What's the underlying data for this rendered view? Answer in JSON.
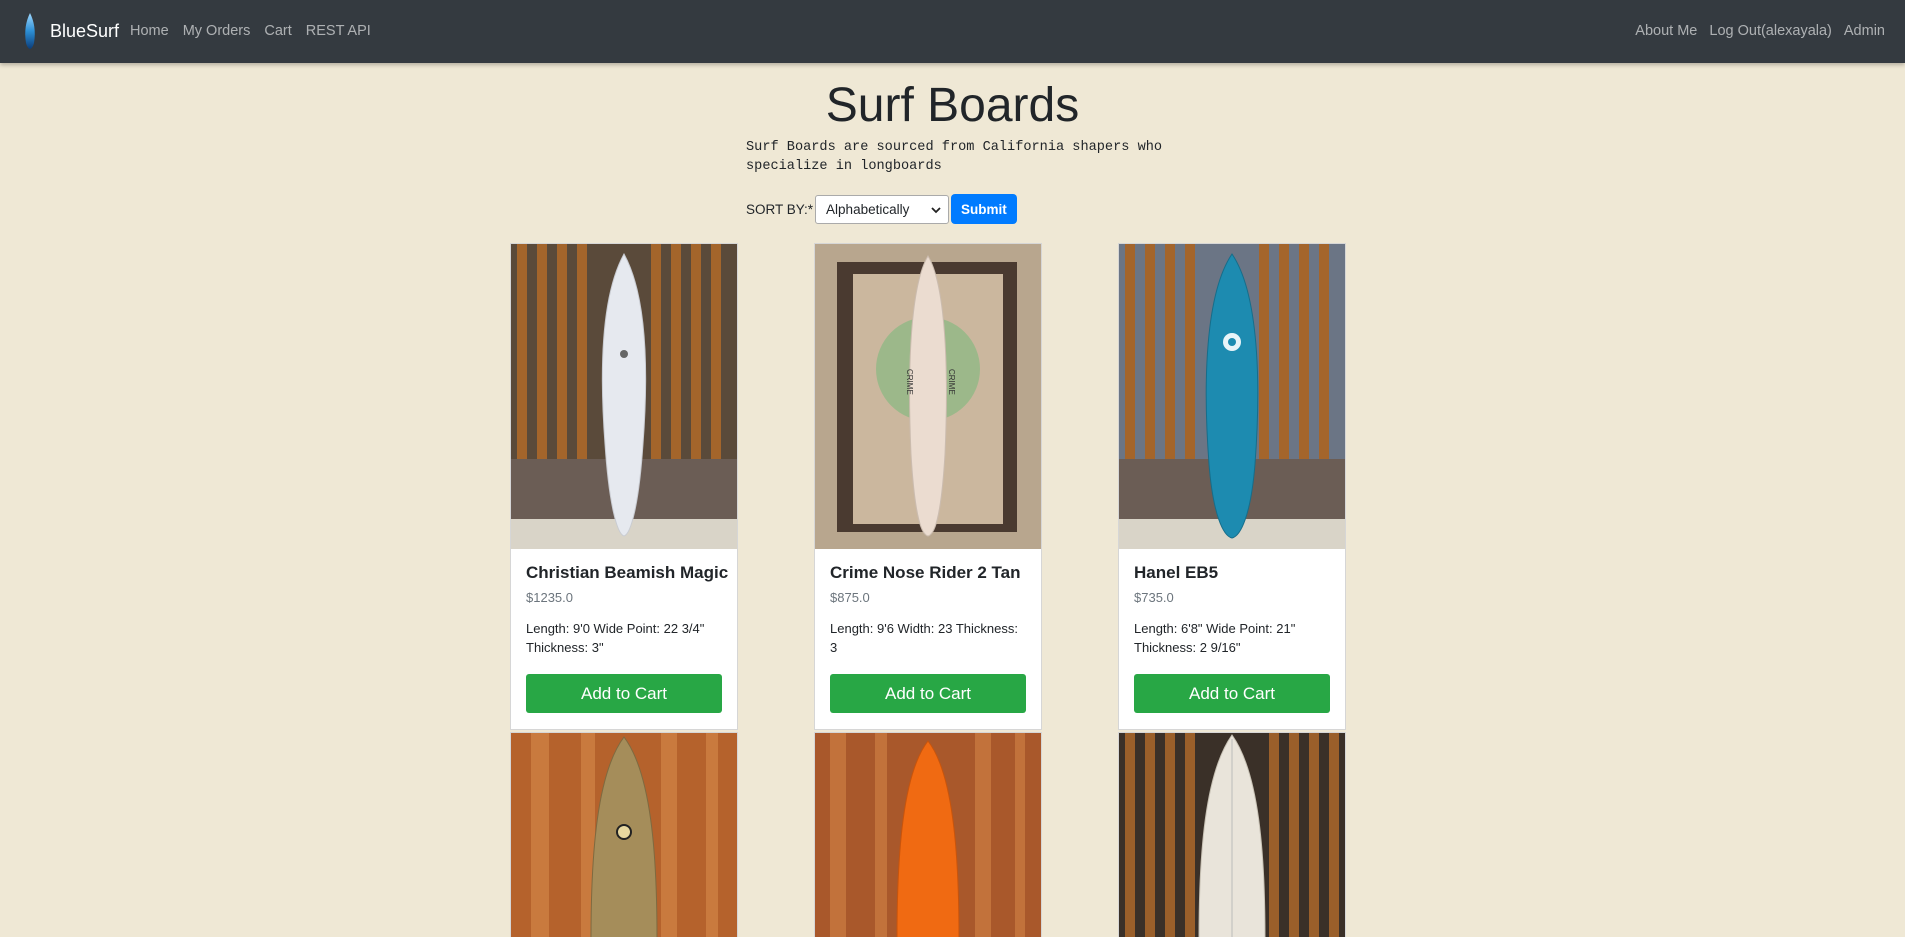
{
  "nav": {
    "brand": "BlueSurf",
    "left_links": [
      "Home",
      "My Orders",
      "Cart",
      "REST API"
    ],
    "right_links": [
      "About Me",
      "Log Out(alexayala)",
      "Admin"
    ]
  },
  "page": {
    "title": "Surf Boards",
    "description": "Surf Boards are sourced from California shapers who specialize in longboards"
  },
  "sort": {
    "label": "SORT BY:*",
    "selected": "Alphabetically",
    "submit_label": "Submit"
  },
  "products": [
    {
      "name": "Christian Beamish Magic",
      "price": "$1235.0",
      "specs": "Length: 9'0 Wide Point: 22 3/4\" Thickness: 3\"",
      "button": "Add to Cart"
    },
    {
      "name": "Crime Nose Rider 2 Tan",
      "price": "$875.0",
      "specs": "Length: 9'6 Width: 23 Thickness: 3",
      "button": "Add to Cart"
    },
    {
      "name": "Hanel EB5",
      "price": "$735.0",
      "specs": "Length: 6'8\" Wide Point: 21\" Thickness: 2 9/16\"",
      "button": "Add to Cart"
    }
  ],
  "colors": {
    "navbar": "#343a40",
    "page_bg": "#efe8d5",
    "primary": "#007bff",
    "success": "#28a745"
  }
}
